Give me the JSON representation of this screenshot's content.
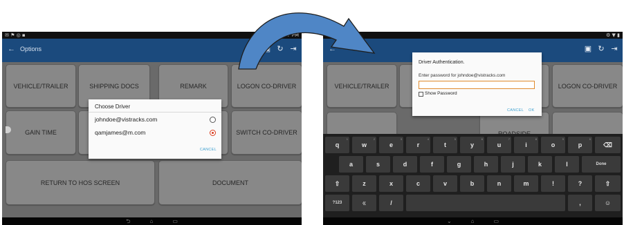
{
  "left_screen": {
    "app_title": "Options",
    "tiles": {
      "vehicle_trailer": "VEHICLE/TRAILER",
      "shipping_docs": "SHIPPING DOCS",
      "remark": "REMARK",
      "logon_co_driver": "LOGON CO-DRIVER",
      "gain_time": "GAIN TIME",
      "switch_co_driver": "SWITCH CO-DRIVER",
      "return_to_hos": "RETURN TO HOS SCREEN",
      "document": "DOCUMENT"
    },
    "dialog": {
      "title": "Choose Driver",
      "options": [
        {
          "email": "johndoe@vistracks.com",
          "selected": false
        },
        {
          "email": "qamjames@m.com",
          "selected": true
        }
      ],
      "cancel_label": "CANCEL"
    }
  },
  "right_screen": {
    "tiles": {
      "vehicle_trailer": "VEHICLE/TRAILER",
      "logon_co_driver": "LOGON CO-DRIVER",
      "roadside": "ROADSIDE"
    },
    "dialog": {
      "title": "Driver Authentication.",
      "prompt": "Enter password for johndoe@vistracks.com",
      "password_value": "",
      "show_password_label": "Show Password",
      "cancel_label": "CANCEL",
      "ok_label": "OK"
    },
    "keyboard": {
      "row1": [
        "q",
        "w",
        "e",
        "r",
        "t",
        "y",
        "u",
        "i",
        "o",
        "p"
      ],
      "row1_hints": [
        "1",
        "2",
        "3",
        "4",
        "5",
        "6",
        "7",
        "8",
        "9",
        "0"
      ],
      "row2": [
        "a",
        "s",
        "d",
        "f",
        "g",
        "h",
        "j",
        "k",
        "l"
      ],
      "done_label": "Done",
      "row3": [
        "z",
        "x",
        "c",
        "v",
        "b",
        "n",
        "m",
        "!",
        "?"
      ],
      "symbols_label": "?123",
      "mic_label": "ㄍ",
      "slash_label": "/",
      "comma_label": ",",
      "period_label": "."
    }
  },
  "colors": {
    "app_bar": "#1b4a7d",
    "arrow": "#4f86c6",
    "accent_radio": "#d83a1b",
    "dialog_link": "#3ca0d0",
    "input_focus": "#e08a2c"
  }
}
